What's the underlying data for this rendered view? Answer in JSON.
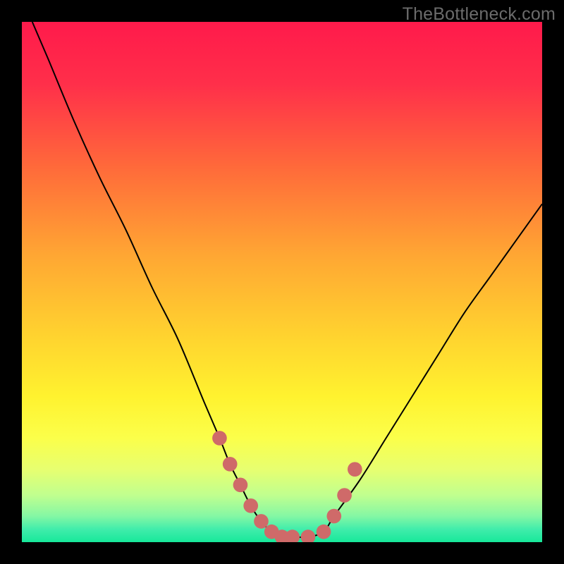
{
  "watermark": "TheBottleneck.com",
  "chart_data": {
    "type": "line",
    "title": "",
    "xlabel": "",
    "ylabel": "",
    "ylim": [
      0,
      100
    ],
    "xlim": [
      0,
      100
    ],
    "series": [
      {
        "name": "bottleneck-curve",
        "x": [
          2,
          5,
          10,
          15,
          20,
          25,
          30,
          35,
          38,
          40,
          42,
          44,
          46,
          48,
          50,
          52,
          55,
          58,
          60,
          65,
          70,
          75,
          80,
          85,
          90,
          95,
          100
        ],
        "y": [
          100,
          93,
          81,
          70,
          60,
          49,
          39,
          27,
          20,
          15,
          11,
          7,
          4,
          2,
          1,
          1,
          1,
          2,
          5,
          12,
          20,
          28,
          36,
          44,
          51,
          58,
          65
        ]
      },
      {
        "name": "dot-markers",
        "x": [
          38,
          40,
          42,
          44,
          46,
          48,
          50,
          52,
          55,
          58,
          60,
          62,
          64
        ],
        "y": [
          20,
          15,
          11,
          7,
          4,
          2,
          1,
          1,
          1,
          2,
          5,
          9,
          14
        ]
      }
    ],
    "gradient_stops": [
      {
        "pos": 0.0,
        "color": "#ff1a4b"
      },
      {
        "pos": 0.12,
        "color": "#ff2f4a"
      },
      {
        "pos": 0.28,
        "color": "#ff6a3a"
      },
      {
        "pos": 0.45,
        "color": "#ffa733"
      },
      {
        "pos": 0.6,
        "color": "#ffd22f"
      },
      {
        "pos": 0.72,
        "color": "#fff22f"
      },
      {
        "pos": 0.8,
        "color": "#fbff4a"
      },
      {
        "pos": 0.86,
        "color": "#e7ff70"
      },
      {
        "pos": 0.91,
        "color": "#c0ff8f"
      },
      {
        "pos": 0.95,
        "color": "#84f7a4"
      },
      {
        "pos": 0.975,
        "color": "#41edab"
      },
      {
        "pos": 1.0,
        "color": "#17e89a"
      }
    ],
    "marker_color": "#cf6a69",
    "curve_color": "#000000"
  }
}
